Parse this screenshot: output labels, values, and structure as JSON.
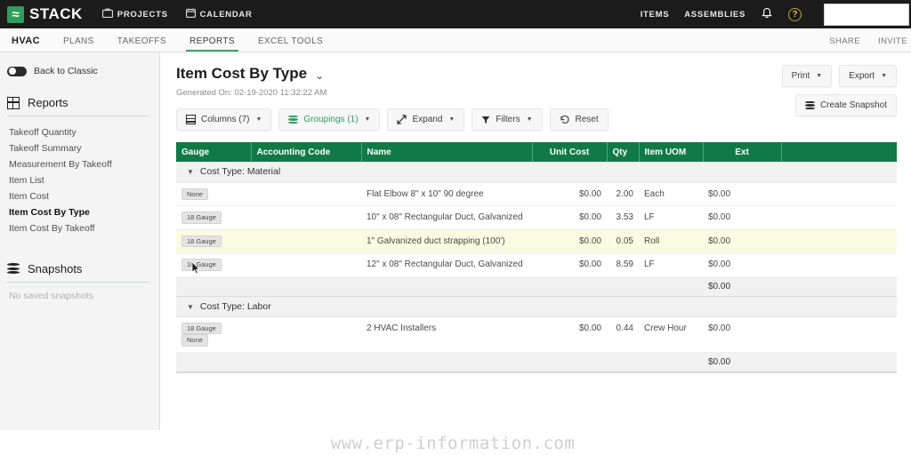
{
  "topbar": {
    "logo_text": "STACK",
    "logo_glyph": "≈",
    "links": [
      {
        "label": "PROJECTS",
        "icon": "briefcase-icon",
        "glyph": "⛁"
      },
      {
        "label": "CALENDAR",
        "icon": "calendar-icon",
        "glyph": "☐"
      }
    ],
    "right_links": [
      {
        "label": "ITEMS"
      },
      {
        "label": "ASSEMBLIES"
      }
    ],
    "bell_icon": "notification-bell-icon",
    "bell_glyph": "🔔",
    "help_icon": "help-icon",
    "help_glyph": "?",
    "accent_green": "#2e9e5b",
    "bar_color": "#1b1b1b"
  },
  "subnav": {
    "project": "HVAC",
    "tabs": [
      {
        "label": "PLANS",
        "active": false
      },
      {
        "label": "TAKEOFFS",
        "active": false
      },
      {
        "label": "REPORTS",
        "active": true
      },
      {
        "label": "EXCEL TOOLS",
        "active": false
      }
    ],
    "share": "SHARE",
    "invite": "INVITE"
  },
  "sidebar": {
    "back_to_classic": "Back to Classic",
    "reports_title": "Reports",
    "reports_icon": "grid-icon",
    "reports": [
      {
        "label": "Takeoff Quantity",
        "current": false
      },
      {
        "label": "Takeoff Summary",
        "current": false
      },
      {
        "label": "Measurement By Takeoff",
        "current": false
      },
      {
        "label": "Item List",
        "current": false
      },
      {
        "label": "Item Cost",
        "current": false
      },
      {
        "label": "Item Cost By Type",
        "current": true
      },
      {
        "label": "Item Cost By Takeoff",
        "current": false
      }
    ],
    "snapshots_title": "Snapshots",
    "snapshots_icon": "database-icon",
    "snapshots_empty": "No saved snapshots"
  },
  "main": {
    "page_title": "Item Cost By Type",
    "title_caret": "⌄",
    "generated_on": "Generated On: 02-19-2020 11:32:22 AM",
    "toolbar": [
      {
        "label": "Columns (7)",
        "icon": "columns-icon",
        "caret": true,
        "green": false
      },
      {
        "label": "Groupings (1)",
        "icon": "groupings-icon",
        "caret": true,
        "green": true
      },
      {
        "label": "Expand",
        "icon": "expand-icon",
        "caret": true,
        "green": false
      },
      {
        "label": "Filters",
        "icon": "filter-icon",
        "caret": true,
        "green": false
      },
      {
        "label": "Reset",
        "icon": "reset-icon",
        "caret": false,
        "green": false
      }
    ],
    "print": "Print",
    "export": "Export",
    "create_snapshot": "Create Snapshot"
  },
  "table": {
    "header_color": "#0f7a45",
    "columns": [
      {
        "label": "Gauge",
        "align": "left"
      },
      {
        "label": "Accounting Code",
        "align": "left"
      },
      {
        "label": "Name",
        "align": "left"
      },
      {
        "label": "Unit Cost",
        "align": "center"
      },
      {
        "label": "Qty",
        "align": "left"
      },
      {
        "label": "Item UOM",
        "align": "left"
      },
      {
        "label": "Ext",
        "align": "center"
      },
      {
        "label": "",
        "align": "left"
      }
    ],
    "groups": [
      {
        "label": "Cost Type: Material",
        "rows": [
          {
            "badges": [
              "None"
            ],
            "accounting_code": "",
            "name": "Flat Elbow 8\" x 10\" 90 degree",
            "unit_cost": "$0.00",
            "qty": "2.00",
            "uom": "Each",
            "ext": "$0.00",
            "highlight": false
          },
          {
            "badges": [
              "18 Gauge"
            ],
            "accounting_code": "",
            "name": "10\" x 08\" Rectangular Duct, Galvanized",
            "unit_cost": "$0.00",
            "qty": "3.53",
            "uom": "LF",
            "ext": "$0.00",
            "highlight": false
          },
          {
            "badges": [
              "18 Gauge"
            ],
            "accounting_code": "",
            "name": "1\" Galvanized duct strapping (100')",
            "unit_cost": "$0.00",
            "qty": "0.05",
            "uom": "Roll",
            "ext": "$0.00",
            "highlight": true
          },
          {
            "badges": [
              "18 Gauge"
            ],
            "accounting_code": "",
            "name": "12\" x 08\" Rectangular Duct, Galvanized",
            "unit_cost": "$0.00",
            "qty": "8.59",
            "uom": "LF",
            "ext": "$0.00",
            "highlight": false
          }
        ],
        "subtotal": "$0.00"
      },
      {
        "label": "Cost Type: Labor",
        "rows": [
          {
            "badges": [
              "18 Gauge",
              "None"
            ],
            "accounting_code": "",
            "name": "2 HVAC Installers",
            "unit_cost": "$0.00",
            "qty": "0.44",
            "uom": "Crew Hour",
            "ext": "$0.00",
            "highlight": false
          }
        ],
        "subtotal": "$0.00"
      }
    ]
  },
  "watermark": "www.erp-information.com"
}
